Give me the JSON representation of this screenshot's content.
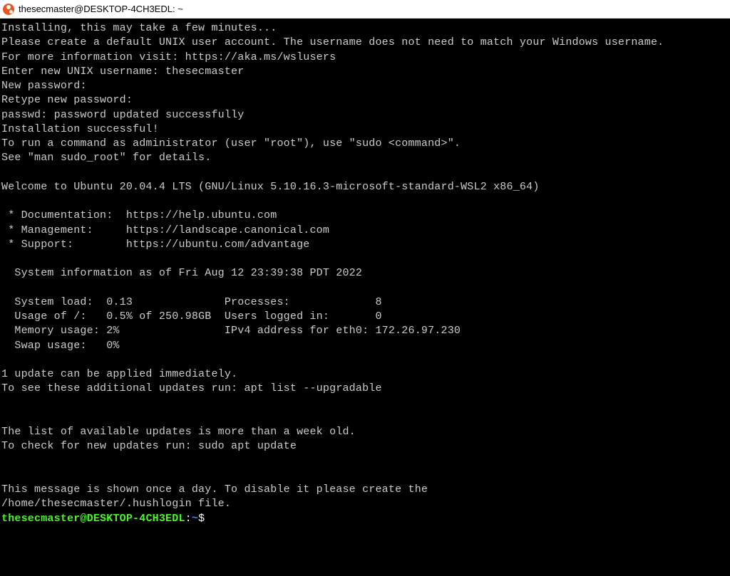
{
  "titlebar": {
    "title": "thesecmaster@DESKTOP-4CH3EDL: ~"
  },
  "lines": {
    "l0": "Installing, this may take a few minutes...",
    "l1": "Please create a default UNIX user account. The username does not need to match your Windows username.",
    "l2": "For more information visit: https://aka.ms/wslusers",
    "l3": "Enter new UNIX username: thesecmaster",
    "l4": "New password:",
    "l5": "Retype new password:",
    "l6": "passwd: password updated successfully",
    "l7": "Installation successful!",
    "l8": "To run a command as administrator (user \"root\"), use \"sudo <command>\".",
    "l9": "See \"man sudo_root\" for details.",
    "l10": "",
    "l11": "Welcome to Ubuntu 20.04.4 LTS (GNU/Linux 5.10.16.3-microsoft-standard-WSL2 x86_64)",
    "l12": "",
    "l13": " * Documentation:  https://help.ubuntu.com",
    "l14": " * Management:     https://landscape.canonical.com",
    "l15": " * Support:        https://ubuntu.com/advantage",
    "l16": "",
    "l17": "  System information as of Fri Aug 12 23:39:38 PDT 2022",
    "l18": "",
    "l19": "  System load:  0.13              Processes:             8",
    "l20": "  Usage of /:   0.5% of 250.98GB  Users logged in:       0",
    "l21": "  Memory usage: 2%                IPv4 address for eth0: 172.26.97.230",
    "l22": "  Swap usage:   0%",
    "l23": "",
    "l24": "1 update can be applied immediately.",
    "l25": "To see these additional updates run: apt list --upgradable",
    "l26": "",
    "l27": "",
    "l28": "The list of available updates is more than a week old.",
    "l29": "To check for new updates run: sudo apt update",
    "l30": "",
    "l31": "",
    "l32": "This message is shown once a day. To disable it please create the",
    "l33": "/home/thesecmaster/.hushlogin file."
  },
  "prompt": {
    "user": "thesecmaster",
    "at": "@",
    "host": "DESKTOP-4CH3EDL",
    "colon": ":",
    "path": "~",
    "dollar": "$"
  }
}
